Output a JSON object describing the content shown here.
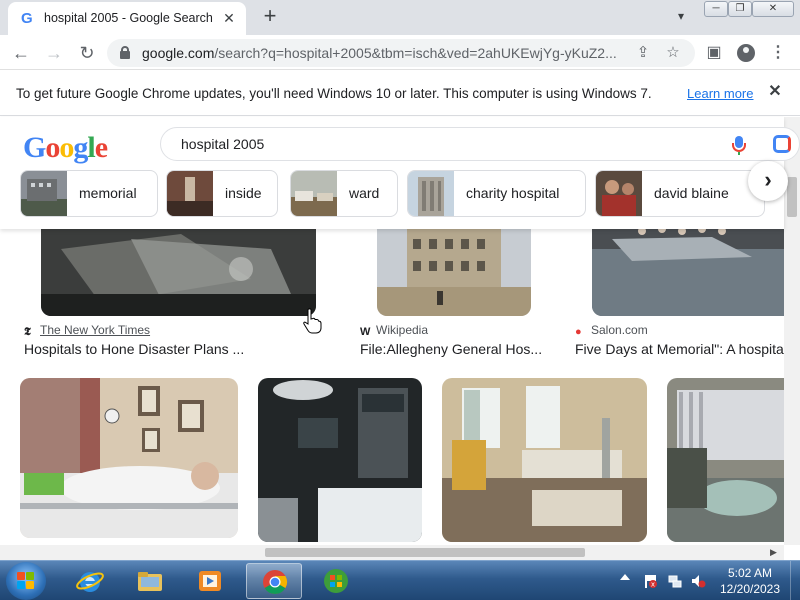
{
  "browser": {
    "tab": {
      "title": "hospital 2005 - Google Search",
      "favicon": "google-g-icon",
      "close": "✕"
    },
    "new_tab": "+",
    "url_host": "google.com",
    "url_rest": "/search?q=hospital+2005&tbm=isch&ved=2ahUKEwjYg-yKuZ2...",
    "window_controls": {
      "minimize": "─",
      "maximize": "❐",
      "close": "✕"
    }
  },
  "infobar": {
    "message": "To get future Google Chrome updates, you'll need Windows 10 or later. This computer is using Windows 7.",
    "link": "Learn more",
    "close": "✕"
  },
  "google": {
    "logo": {
      "g": "G",
      "o1": "o",
      "o2": "o",
      "g2": "g",
      "l": "l",
      "e": "e"
    },
    "query": "hospital 2005",
    "chips": [
      {
        "label": "memorial"
      },
      {
        "label": "inside"
      },
      {
        "label": "ward"
      },
      {
        "label": "charity hospital"
      },
      {
        "label": "david blaine"
      }
    ],
    "chips_next": "›"
  },
  "results": {
    "row1": [
      {
        "source": "The New York Times",
        "source_icon": "nyt-icon",
        "caption": "Hospitals to Hone Disaster Plans ..."
      },
      {
        "source": "Wikipedia",
        "source_icon": "wikipedia-icon",
        "caption": "File:Allegheny General Hos..."
      },
      {
        "source": "Salon.com",
        "source_icon": "salon-icon",
        "caption": "Five Days at Memorial\": A hospita"
      }
    ]
  },
  "taskbar": {
    "time": "5:02 AM",
    "date": "12/20/2023"
  }
}
